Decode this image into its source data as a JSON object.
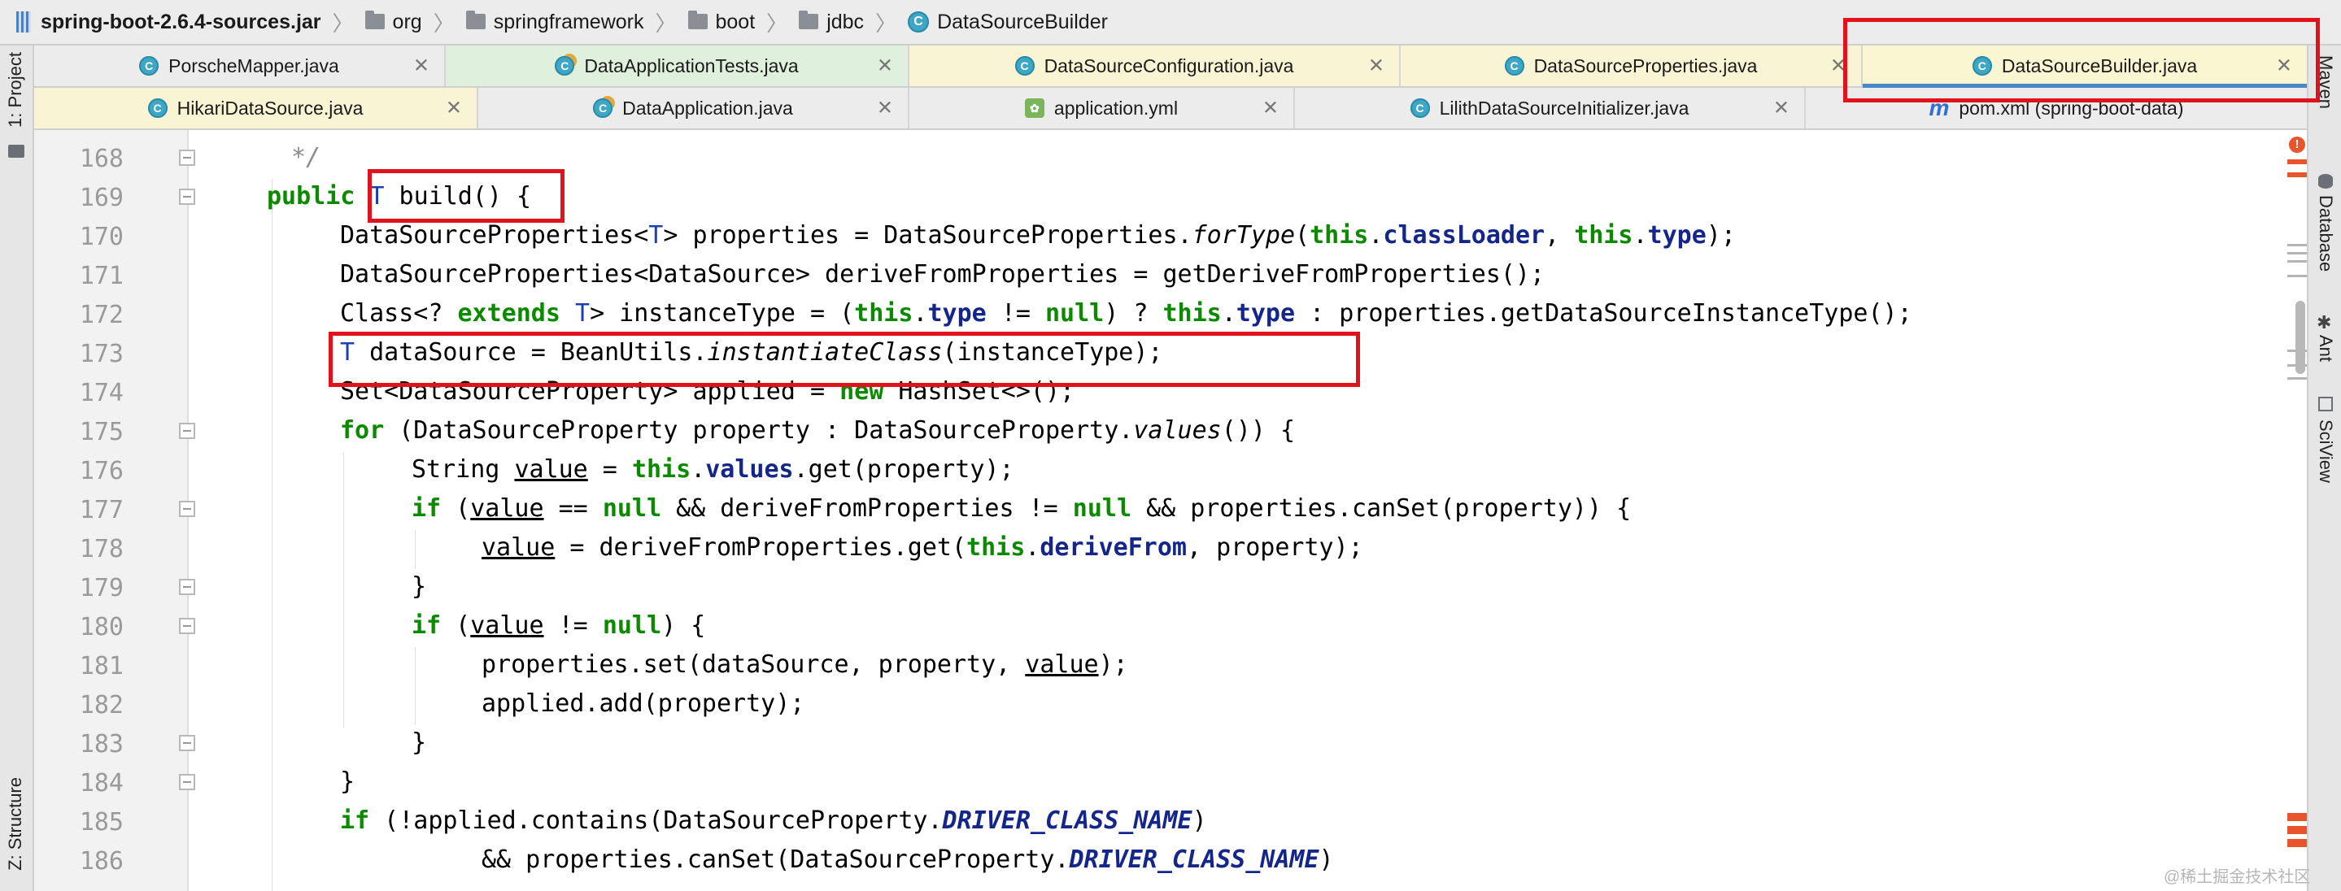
{
  "breadcrumb": [
    {
      "label": "spring-boot-2.6.4-sources.jar",
      "icon": "jar-icon"
    },
    {
      "label": "org",
      "icon": "folder-icon"
    },
    {
      "label": "springframework",
      "icon": "folder-icon"
    },
    {
      "label": "boot",
      "icon": "folder-icon"
    },
    {
      "label": "jdbc",
      "icon": "folder-icon"
    },
    {
      "label": "DataSourceBuilder",
      "icon": "class-icon"
    }
  ],
  "left_tools": {
    "project": "1: Project",
    "structure": "Z: Structure"
  },
  "right_tools": {
    "maven": "Maven",
    "database": "Database",
    "ant": "Ant",
    "sciview": "SciView"
  },
  "tabs_row1": [
    {
      "label": "PorscheMapper.java",
      "icon": "class-icon",
      "state": "normal"
    },
    {
      "label": "DataApplicationTests.java",
      "icon": "test-class-icon",
      "state": "green"
    },
    {
      "label": "DataSourceConfiguration.java",
      "icon": "class-icon",
      "state": "yellow"
    },
    {
      "label": "DataSourceProperties.java",
      "icon": "class-icon",
      "state": "yellow"
    },
    {
      "label": "DataSourceBuilder.java",
      "icon": "class-icon",
      "state": "active"
    }
  ],
  "tabs_row2": [
    {
      "label": "HikariDataSource.java",
      "icon": "class-icon",
      "state": "yellow"
    },
    {
      "label": "DataApplication.java",
      "icon": "class-icon",
      "state": "normal"
    },
    {
      "label": "application.yml",
      "icon": "yml-icon",
      "state": "normal"
    },
    {
      "label": "LilithDataSourceInitializer.java",
      "icon": "class-icon",
      "state": "normal"
    },
    {
      "label": "pom.xml (spring-boot-data)",
      "icon": "maven-icon",
      "state": "normal"
    }
  ],
  "editor": {
    "line_numbers": [
      "168",
      "169",
      "170",
      "171",
      "172",
      "173",
      "174",
      "175",
      "176",
      "177",
      "178",
      "179",
      "180",
      "181",
      "182",
      "183",
      "184",
      "185",
      "186"
    ]
  },
  "colors": {
    "highlight_box": "#e0121b",
    "active_tab_bg": "#fbf6d2",
    "keyword": "#0b8a00"
  },
  "watermark": "@稀土掘金技术社区"
}
